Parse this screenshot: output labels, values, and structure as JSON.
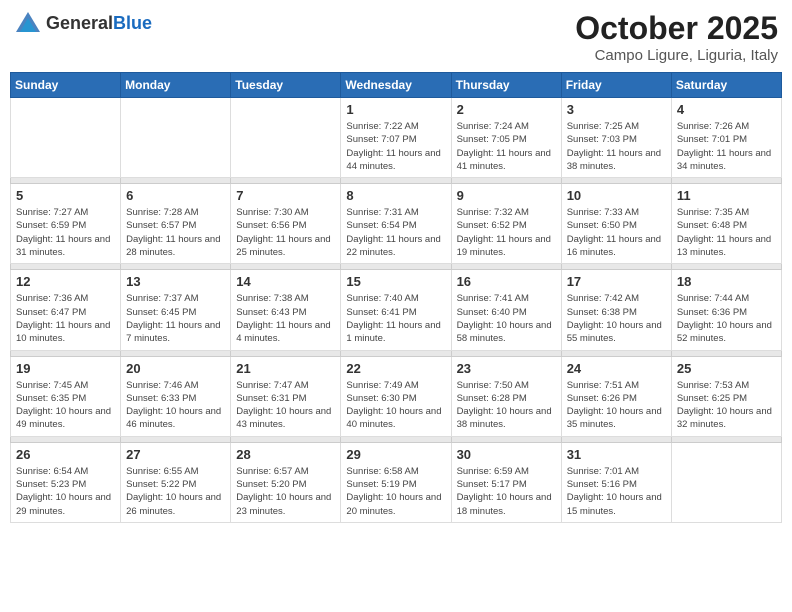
{
  "header": {
    "logo_general": "General",
    "logo_blue": "Blue",
    "month": "October 2025",
    "location": "Campo Ligure, Liguria, Italy"
  },
  "weekdays": [
    "Sunday",
    "Monday",
    "Tuesday",
    "Wednesday",
    "Thursday",
    "Friday",
    "Saturday"
  ],
  "weeks": [
    [
      {
        "day": "",
        "sunrise": "",
        "sunset": "",
        "daylight": ""
      },
      {
        "day": "",
        "sunrise": "",
        "sunset": "",
        "daylight": ""
      },
      {
        "day": "",
        "sunrise": "",
        "sunset": "",
        "daylight": ""
      },
      {
        "day": "1",
        "sunrise": "Sunrise: 7:22 AM",
        "sunset": "Sunset: 7:07 PM",
        "daylight": "Daylight: 11 hours and 44 minutes."
      },
      {
        "day": "2",
        "sunrise": "Sunrise: 7:24 AM",
        "sunset": "Sunset: 7:05 PM",
        "daylight": "Daylight: 11 hours and 41 minutes."
      },
      {
        "day": "3",
        "sunrise": "Sunrise: 7:25 AM",
        "sunset": "Sunset: 7:03 PM",
        "daylight": "Daylight: 11 hours and 38 minutes."
      },
      {
        "day": "4",
        "sunrise": "Sunrise: 7:26 AM",
        "sunset": "Sunset: 7:01 PM",
        "daylight": "Daylight: 11 hours and 34 minutes."
      }
    ],
    [
      {
        "day": "5",
        "sunrise": "Sunrise: 7:27 AM",
        "sunset": "Sunset: 6:59 PM",
        "daylight": "Daylight: 11 hours and 31 minutes."
      },
      {
        "day": "6",
        "sunrise": "Sunrise: 7:28 AM",
        "sunset": "Sunset: 6:57 PM",
        "daylight": "Daylight: 11 hours and 28 minutes."
      },
      {
        "day": "7",
        "sunrise": "Sunrise: 7:30 AM",
        "sunset": "Sunset: 6:56 PM",
        "daylight": "Daylight: 11 hours and 25 minutes."
      },
      {
        "day": "8",
        "sunrise": "Sunrise: 7:31 AM",
        "sunset": "Sunset: 6:54 PM",
        "daylight": "Daylight: 11 hours and 22 minutes."
      },
      {
        "day": "9",
        "sunrise": "Sunrise: 7:32 AM",
        "sunset": "Sunset: 6:52 PM",
        "daylight": "Daylight: 11 hours and 19 minutes."
      },
      {
        "day": "10",
        "sunrise": "Sunrise: 7:33 AM",
        "sunset": "Sunset: 6:50 PM",
        "daylight": "Daylight: 11 hours and 16 minutes."
      },
      {
        "day": "11",
        "sunrise": "Sunrise: 7:35 AM",
        "sunset": "Sunset: 6:48 PM",
        "daylight": "Daylight: 11 hours and 13 minutes."
      }
    ],
    [
      {
        "day": "12",
        "sunrise": "Sunrise: 7:36 AM",
        "sunset": "Sunset: 6:47 PM",
        "daylight": "Daylight: 11 hours and 10 minutes."
      },
      {
        "day": "13",
        "sunrise": "Sunrise: 7:37 AM",
        "sunset": "Sunset: 6:45 PM",
        "daylight": "Daylight: 11 hours and 7 minutes."
      },
      {
        "day": "14",
        "sunrise": "Sunrise: 7:38 AM",
        "sunset": "Sunset: 6:43 PM",
        "daylight": "Daylight: 11 hours and 4 minutes."
      },
      {
        "day": "15",
        "sunrise": "Sunrise: 7:40 AM",
        "sunset": "Sunset: 6:41 PM",
        "daylight": "Daylight: 11 hours and 1 minute."
      },
      {
        "day": "16",
        "sunrise": "Sunrise: 7:41 AM",
        "sunset": "Sunset: 6:40 PM",
        "daylight": "Daylight: 10 hours and 58 minutes."
      },
      {
        "day": "17",
        "sunrise": "Sunrise: 7:42 AM",
        "sunset": "Sunset: 6:38 PM",
        "daylight": "Daylight: 10 hours and 55 minutes."
      },
      {
        "day": "18",
        "sunrise": "Sunrise: 7:44 AM",
        "sunset": "Sunset: 6:36 PM",
        "daylight": "Daylight: 10 hours and 52 minutes."
      }
    ],
    [
      {
        "day": "19",
        "sunrise": "Sunrise: 7:45 AM",
        "sunset": "Sunset: 6:35 PM",
        "daylight": "Daylight: 10 hours and 49 minutes."
      },
      {
        "day": "20",
        "sunrise": "Sunrise: 7:46 AM",
        "sunset": "Sunset: 6:33 PM",
        "daylight": "Daylight: 10 hours and 46 minutes."
      },
      {
        "day": "21",
        "sunrise": "Sunrise: 7:47 AM",
        "sunset": "Sunset: 6:31 PM",
        "daylight": "Daylight: 10 hours and 43 minutes."
      },
      {
        "day": "22",
        "sunrise": "Sunrise: 7:49 AM",
        "sunset": "Sunset: 6:30 PM",
        "daylight": "Daylight: 10 hours and 40 minutes."
      },
      {
        "day": "23",
        "sunrise": "Sunrise: 7:50 AM",
        "sunset": "Sunset: 6:28 PM",
        "daylight": "Daylight: 10 hours and 38 minutes."
      },
      {
        "day": "24",
        "sunrise": "Sunrise: 7:51 AM",
        "sunset": "Sunset: 6:26 PM",
        "daylight": "Daylight: 10 hours and 35 minutes."
      },
      {
        "day": "25",
        "sunrise": "Sunrise: 7:53 AM",
        "sunset": "Sunset: 6:25 PM",
        "daylight": "Daylight: 10 hours and 32 minutes."
      }
    ],
    [
      {
        "day": "26",
        "sunrise": "Sunrise: 6:54 AM",
        "sunset": "Sunset: 5:23 PM",
        "daylight": "Daylight: 10 hours and 29 minutes."
      },
      {
        "day": "27",
        "sunrise": "Sunrise: 6:55 AM",
        "sunset": "Sunset: 5:22 PM",
        "daylight": "Daylight: 10 hours and 26 minutes."
      },
      {
        "day": "28",
        "sunrise": "Sunrise: 6:57 AM",
        "sunset": "Sunset: 5:20 PM",
        "daylight": "Daylight: 10 hours and 23 minutes."
      },
      {
        "day": "29",
        "sunrise": "Sunrise: 6:58 AM",
        "sunset": "Sunset: 5:19 PM",
        "daylight": "Daylight: 10 hours and 20 minutes."
      },
      {
        "day": "30",
        "sunrise": "Sunrise: 6:59 AM",
        "sunset": "Sunset: 5:17 PM",
        "daylight": "Daylight: 10 hours and 18 minutes."
      },
      {
        "day": "31",
        "sunrise": "Sunrise: 7:01 AM",
        "sunset": "Sunset: 5:16 PM",
        "daylight": "Daylight: 10 hours and 15 minutes."
      },
      {
        "day": "",
        "sunrise": "",
        "sunset": "",
        "daylight": ""
      }
    ]
  ]
}
